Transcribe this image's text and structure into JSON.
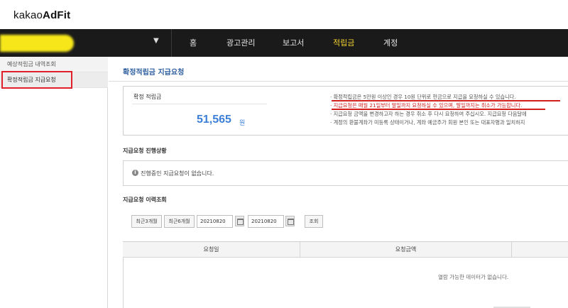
{
  "brand": {
    "prefix": "kakao",
    "name": "AdFit"
  },
  "account": {
    "caret": "▼",
    "highlight_color": "#f7e71a"
  },
  "nav": [
    {
      "label": "홈",
      "active": false
    },
    {
      "label": "광고관리",
      "active": false
    },
    {
      "label": "보고서",
      "active": false
    },
    {
      "label": "적립금",
      "active": true
    },
    {
      "label": "계정",
      "active": false
    }
  ],
  "sidebar": {
    "items": [
      {
        "label": "예상적립금 내역조회"
      },
      {
        "label": "확정적립금 지급요청"
      }
    ]
  },
  "page": {
    "title": "확정적립금 지급요청"
  },
  "confirmed": {
    "label": "확정 적립금",
    "amount": "51,565",
    "unit": "원",
    "notes": [
      "· 확정적립금은 5만원 이상인 경우 10원 단위로 현금으로 지급을 요청하실 수 있습니다.",
      "· 지급요청은 매월 21일부터 말일까지 요청하실 수 있으며, 말일까지는 취소가 가능합니다.",
      "· 지급요청 금액을 변경하고자 하는 경우 취소 후 다시 요청하여 주십시오. 지급요청 다음달에",
      "· 계정의 환불계좌가 미등록 상태이거나, 계좌 예금주가 회원 본인 또는 대표자명과 일치하지"
    ]
  },
  "status": {
    "title": "지급요청 진행상황",
    "icon": "info-icon",
    "message": "진행중인 지급요청이 없습니다."
  },
  "history": {
    "title": "지급요청 이력조회",
    "buttons": [
      "최근3개월",
      "최근6개월"
    ],
    "date_from": "20210820",
    "date_to": "20210820",
    "separator": "~",
    "search_label": "조회",
    "columns": [
      "요청일",
      "요청금액"
    ],
    "empty_message": "열람 가능한 데이터가 없습니다."
  },
  "colors": {
    "accent": "#2d5e9e",
    "amount": "#3c7fd8",
    "highlight": "#d0201f",
    "nav_active": "#f5d432"
  }
}
